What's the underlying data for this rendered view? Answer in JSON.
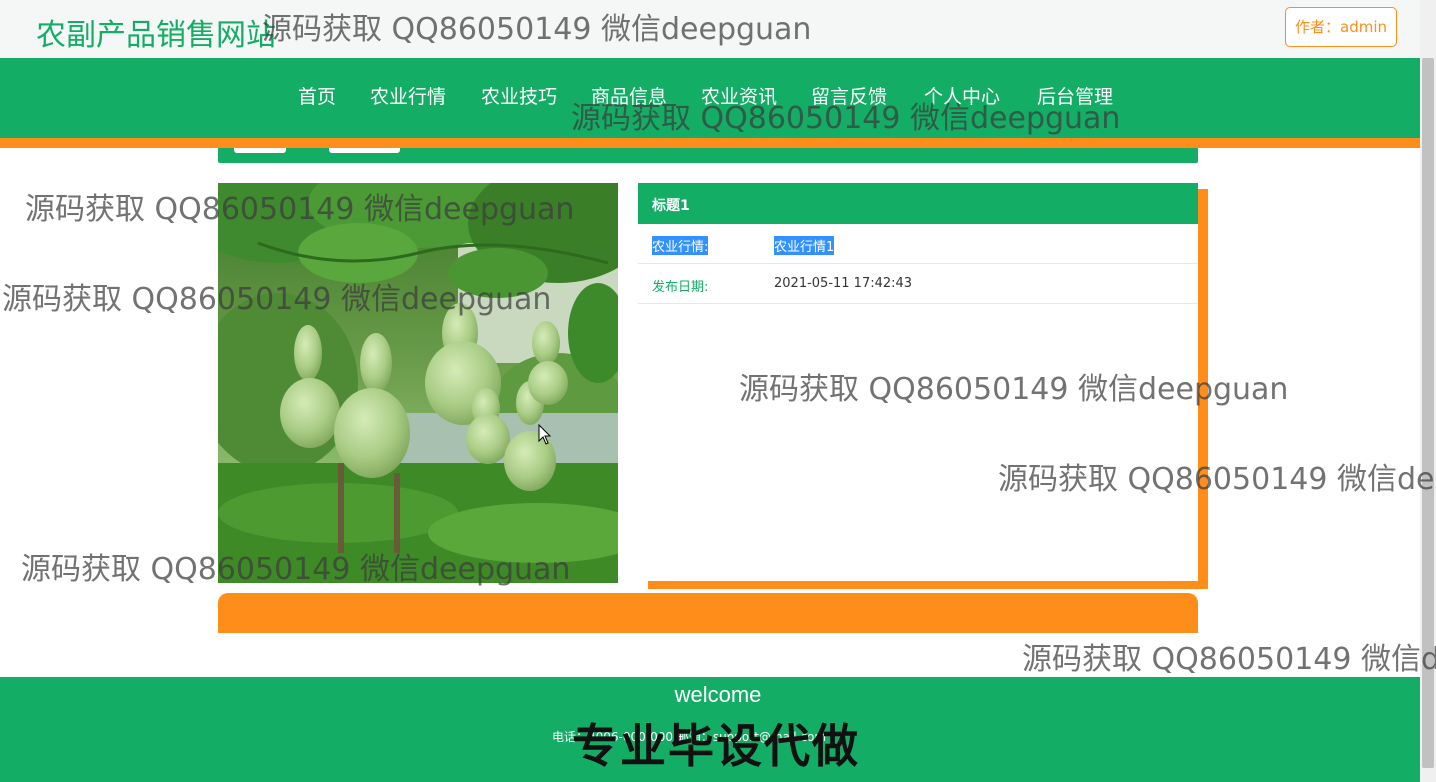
{
  "header": {
    "site_title": "农副产品销售网站",
    "author_label": "作者：admin"
  },
  "nav": {
    "items": [
      "首页",
      "农业行情",
      "农业技巧",
      "商品信息",
      "农业资讯",
      "留言反馈",
      "个人中心",
      "后台管理"
    ]
  },
  "detail": {
    "title": "标题1",
    "rows": [
      {
        "label": "农业行情:",
        "value": "农业行情1",
        "selected": true
      },
      {
        "label": "发布日期:",
        "value": "2021-05-11 17:42:43",
        "selected": false
      }
    ]
  },
  "footer": {
    "welcome": "welcome",
    "contact": "电话：4006-000-000 邮箱：support@mail.com",
    "overlay_text": "专业毕设代做"
  },
  "watermark": {
    "text": "源码获取 QQ86050149 微信deepguan"
  },
  "colors": {
    "primary_green": "#13ad66",
    "accent_orange": "#ff8d1a",
    "selection_blue": "#3391ff"
  }
}
